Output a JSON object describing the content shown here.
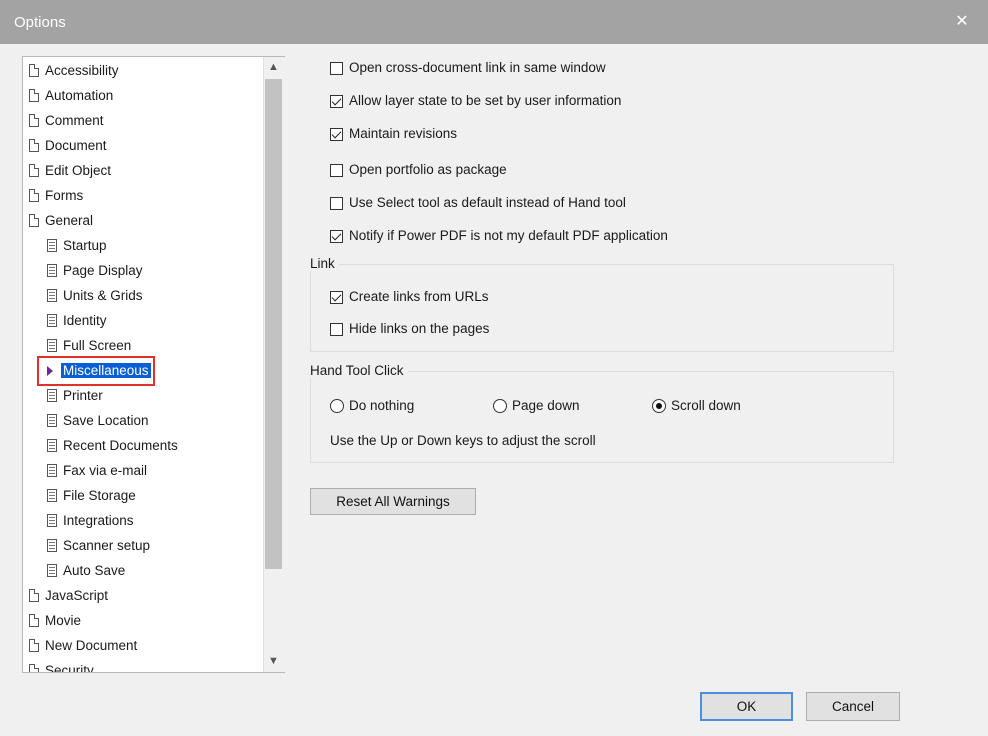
{
  "window": {
    "title": "Options"
  },
  "tree": {
    "items": [
      {
        "label": "Accessibility",
        "level": 0
      },
      {
        "label": "Automation",
        "level": 0
      },
      {
        "label": "Comment",
        "level": 0
      },
      {
        "label": "Document",
        "level": 0
      },
      {
        "label": "Edit Object",
        "level": 0
      },
      {
        "label": "Forms",
        "level": 0
      },
      {
        "label": "General",
        "level": 0
      },
      {
        "label": "Startup",
        "level": 1
      },
      {
        "label": "Page Display",
        "level": 1
      },
      {
        "label": "Units & Grids",
        "level": 1
      },
      {
        "label": "Identity",
        "level": 1
      },
      {
        "label": "Full Screen",
        "level": 1
      },
      {
        "label": "Miscellaneous",
        "level": 1,
        "selected": true
      },
      {
        "label": "Printer",
        "level": 1
      },
      {
        "label": "Save Location",
        "level": 1
      },
      {
        "label": "Recent Documents",
        "level": 1
      },
      {
        "label": "Fax via e-mail",
        "level": 1
      },
      {
        "label": "File Storage",
        "level": 1
      },
      {
        "label": "Integrations",
        "level": 1
      },
      {
        "label": "Scanner setup",
        "level": 1
      },
      {
        "label": "Auto Save",
        "level": 1
      },
      {
        "label": "JavaScript",
        "level": 0
      },
      {
        "label": "Movie",
        "level": 0
      },
      {
        "label": "New Document",
        "level": 0
      },
      {
        "label": "Security",
        "level": 0
      }
    ]
  },
  "options": [
    {
      "label": "Open cross-document link in same window",
      "checked": false
    },
    {
      "label": "Allow layer state to be set by user information",
      "checked": true
    },
    {
      "label": "Maintain revisions",
      "checked": true
    },
    {
      "label": "Open portfolio as package",
      "checked": false
    },
    {
      "label": "Use Select tool as default instead of Hand tool",
      "checked": false
    },
    {
      "label": "Notify if Power PDF is not my default PDF application",
      "checked": true
    }
  ],
  "link_group": {
    "title": "Link",
    "options": [
      {
        "label": "Create links from URLs",
        "checked": true
      },
      {
        "label": "Hide links on the pages",
        "checked": false
      }
    ]
  },
  "hand_tool_group": {
    "title": "Hand Tool Click",
    "radios": [
      {
        "label": "Do nothing",
        "selected": false
      },
      {
        "label": "Page down",
        "selected": false
      },
      {
        "label": "Scroll down",
        "selected": true
      }
    ],
    "hint": "Use the Up or Down keys to adjust the scroll"
  },
  "buttons": {
    "reset": "Reset All Warnings",
    "ok": "OK",
    "cancel": "Cancel"
  },
  "icons": {
    "close": "close-icon",
    "scroll_up": "chevron-up-icon",
    "scroll_down": "chevron-down-icon"
  },
  "colors": {
    "selection": "#0a5fd6",
    "highlight_box": "#e13030",
    "titlebar": "#a3a3a3"
  }
}
